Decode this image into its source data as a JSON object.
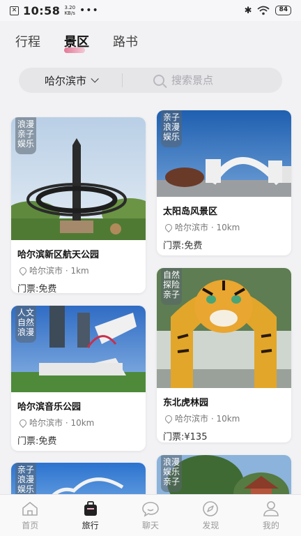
{
  "status": {
    "time": "10:58",
    "speed_value": "3.20",
    "speed_unit": "KB/s",
    "dots": "•••",
    "battery": "84"
  },
  "tabs": [
    {
      "label": "行程"
    },
    {
      "label": "景区"
    },
    {
      "label": "路书"
    }
  ],
  "search": {
    "city": "哈尔滨市",
    "placeholder": "搜索景点"
  },
  "cards": [
    {
      "tags": "浪漫\n亲子\n娱乐",
      "title": "哈尔滨新区航天公园",
      "location": "哈尔滨市 · 1km",
      "ticket": "门票:免费"
    },
    {
      "tags": "亲子\n浪漫\n娱乐",
      "title": "太阳岛风景区",
      "location": "哈尔滨市 · 10km",
      "ticket": "门票:免费"
    },
    {
      "tags": "人文\n自然\n浪漫",
      "title": "哈尔滨音乐公园",
      "location": "哈尔滨市 · 10km",
      "ticket": "门票:免费"
    },
    {
      "tags": "自然\n探险\n亲子",
      "title": "东北虎林园",
      "location": "哈尔滨市 · 10km",
      "ticket": "门票:¥135"
    },
    {
      "tags": "亲子\n浪漫\n娱乐"
    },
    {
      "tags": "浪漫\n娱乐\n亲子"
    }
  ],
  "nav": [
    {
      "label": "首页"
    },
    {
      "label": "旅行"
    },
    {
      "label": "聊天"
    },
    {
      "label": "发现"
    },
    {
      "label": "我的"
    }
  ],
  "colors": {
    "accent": "#e26a8c",
    "active_text": "#111111",
    "inactive_text": "#999999"
  }
}
